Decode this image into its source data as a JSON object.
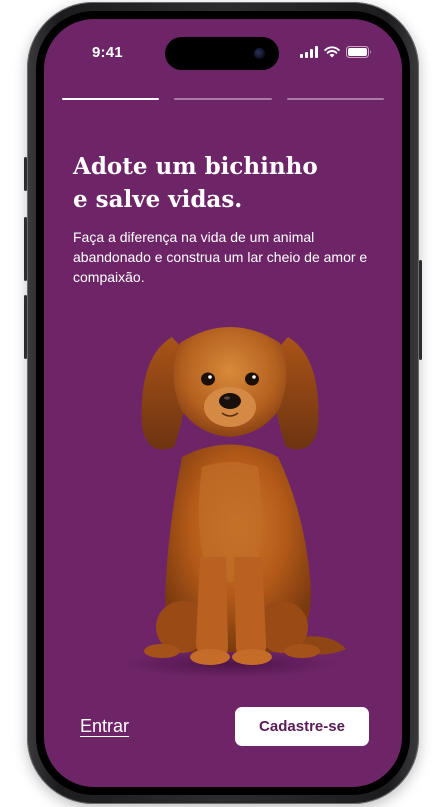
{
  "status_bar": {
    "time": "9:41",
    "icons": [
      "cellular-signal-icon",
      "wifi-icon",
      "battery-icon"
    ]
  },
  "onboarding": {
    "steps_total": 3,
    "current_step": 1,
    "title_line_1": "Adote um bichinho",
    "title_line_2": "e salve vidas.",
    "description": "Faça a diferença na vida de um animal abandonado e construa um lar cheio de amor e compaixão.",
    "illustration": "dog-illustration"
  },
  "actions": {
    "login_label": "Entrar",
    "signup_label": "Cadastre-se"
  },
  "colors": {
    "background": "#6e2568",
    "accent_text": "#5b1b57",
    "button_bg": "#ffffff"
  }
}
